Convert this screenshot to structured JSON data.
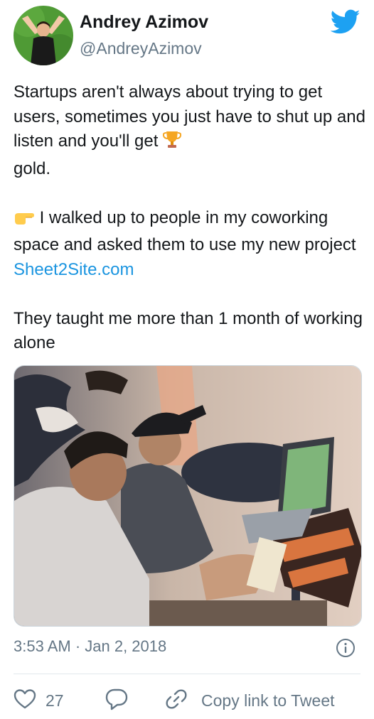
{
  "author": {
    "name": "Andrey Azimov",
    "handle": "@AndreyAzimov"
  },
  "tweet": {
    "para1_text": "Startups aren't always about trying to get users, sometimes you just have to shut up and listen and you'll get",
    "para1_emoji": "trophy-emoji",
    "para1_end": "gold.",
    "para2_emoji": "pointing-right-emoji",
    "para2_text": "I walked up to people in my coworking space and asked them to use my new project",
    "para2_link": "Sheet2Site.com",
    "para3_text": "They taught me more than 1 month of working alone"
  },
  "timestamp": "3:53 AM · Jan 2, 2018",
  "actions": {
    "like_count": "27",
    "copy_link_label": "Copy link to Tweet"
  },
  "icons": {
    "brand": "twitter-bird-icon",
    "info": "info-icon",
    "like": "heart-icon",
    "reply": "reply-bubble-icon",
    "copy": "link-icon"
  },
  "colors": {
    "brand": "#1da1f2",
    "link": "#1b95e0",
    "secondary_text": "#657786"
  }
}
